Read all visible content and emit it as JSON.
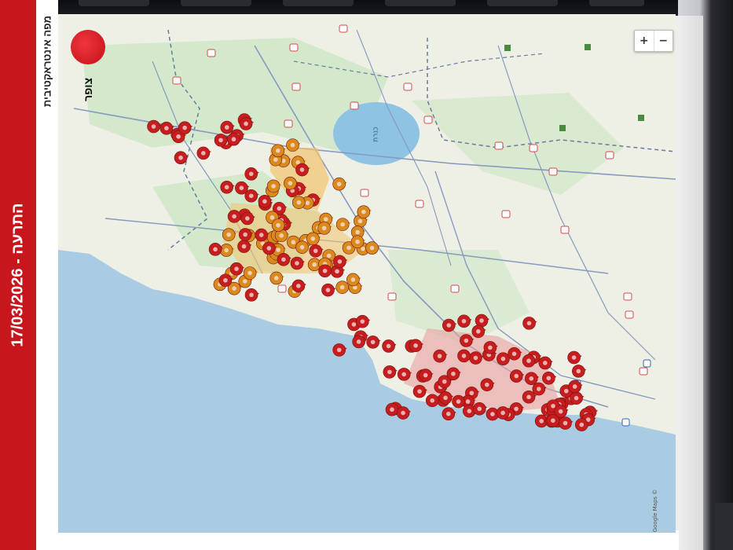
{
  "header": {
    "alert_title": "התרעה - 17/03/2026",
    "subtitle": "מפה אינטראקטיבית"
  },
  "app": {
    "logo_name": "צופר"
  },
  "map": {
    "zoom_in_label": "+",
    "zoom_out_label": "−",
    "attribution": "Google Maps ©",
    "lake_label": "כנרת",
    "colors": {
      "sea": "#a9cce3",
      "land": "#eef0e6",
      "green": "#cfe6c5",
      "road": "#7c8fb3",
      "alert_red": "#c61e1e",
      "alert_orange": "#d98a1d"
    },
    "alert_zones": [
      {
        "name": "north-cluster",
        "color": "red"
      },
      {
        "name": "galilee-cluster",
        "color": "orange"
      },
      {
        "name": "haifa-cluster",
        "color": "red"
      }
    ]
  },
  "colors": {
    "header_red": "#c8161d",
    "accent": "#c8161d"
  },
  "icons": {
    "zoom_in": "plus-icon",
    "zoom_out": "minus-icon",
    "alert_pin": "alert-pin-icon",
    "logo": "tzofar-logo-icon"
  }
}
